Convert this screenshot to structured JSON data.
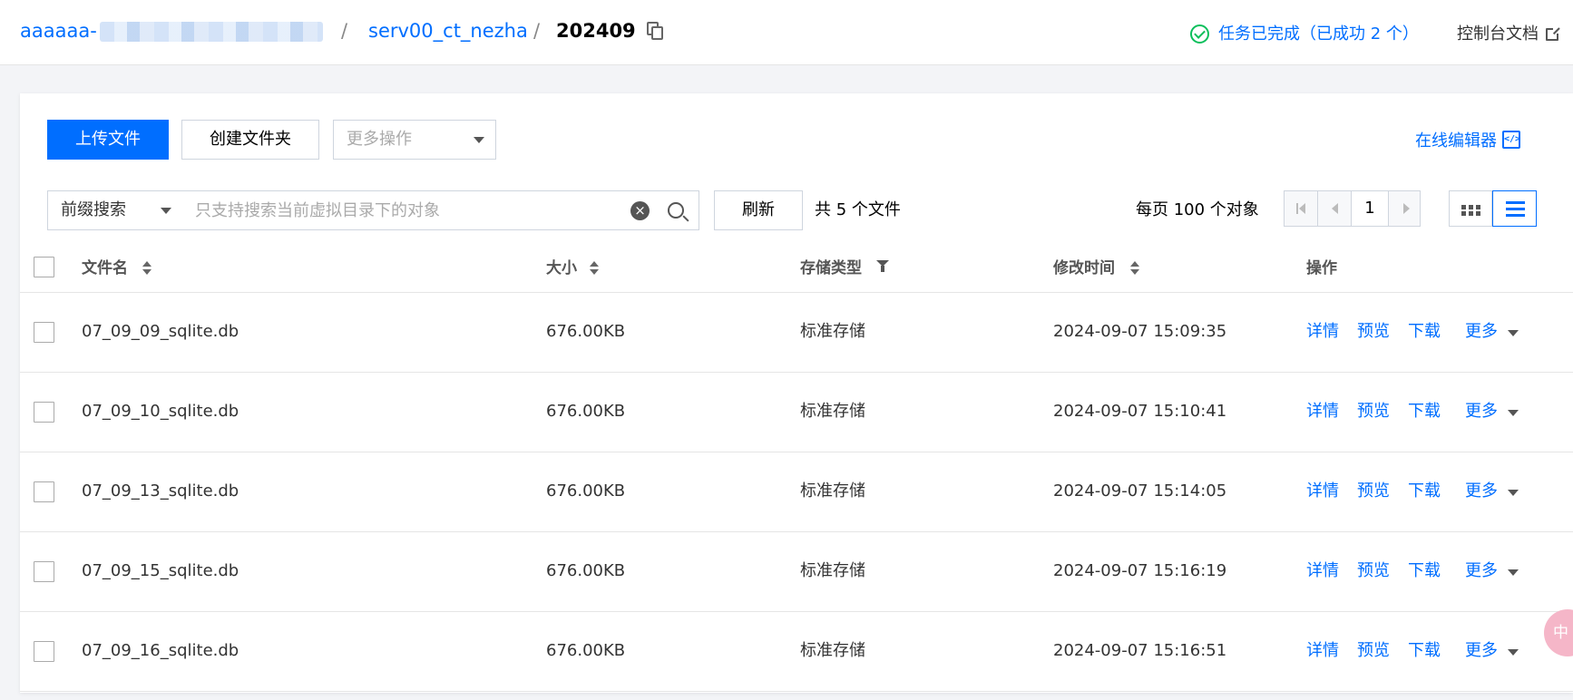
{
  "breadcrumb": {
    "bucket": "aaaaaa-",
    "sep1": "/",
    "folder": "serv00_ct_nezha",
    "sep2": "/",
    "current": "202409"
  },
  "header": {
    "task_status": "任务已完成（已成功 2 个）",
    "console_doc": "控制台文档"
  },
  "toolbar": {
    "upload": "上传文件",
    "create_folder": "创建文件夹",
    "more_actions": "更多操作",
    "online_editor": "在线编辑器"
  },
  "search": {
    "mode": "前缀搜索",
    "placeholder": "只支持搜索当前虚拟目录下的对象",
    "refresh": "刷新",
    "count": "共 5 个文件"
  },
  "pagination": {
    "per_page": "每页 100 个对象",
    "page": "1"
  },
  "table": {
    "headers": {
      "name": "文件名",
      "size": "大小",
      "storage": "存储类型",
      "modified": "修改时间",
      "actions": "操作"
    },
    "rows": [
      {
        "name": "07_09_09_sqlite.db",
        "size": "676.00KB",
        "storage": "标准存储",
        "modified": "2024-09-07 15:09:35"
      },
      {
        "name": "07_09_10_sqlite.db",
        "size": "676.00KB",
        "storage": "标准存储",
        "modified": "2024-09-07 15:10:41"
      },
      {
        "name": "07_09_13_sqlite.db",
        "size": "676.00KB",
        "storage": "标准存储",
        "modified": "2024-09-07 15:14:05"
      },
      {
        "name": "07_09_15_sqlite.db",
        "size": "676.00KB",
        "storage": "标准存储",
        "modified": "2024-09-07 15:16:19"
      },
      {
        "name": "07_09_16_sqlite.db",
        "size": "676.00KB",
        "storage": "标准存储",
        "modified": "2024-09-07 15:16:51"
      }
    ],
    "row_actions": {
      "details": "详情",
      "preview": "预览",
      "download": "下载",
      "more": "更多"
    }
  },
  "float_badge": "中",
  "colors": {
    "primary": "#006eff",
    "success": "#0abf5b",
    "border": "#cfd5de"
  }
}
